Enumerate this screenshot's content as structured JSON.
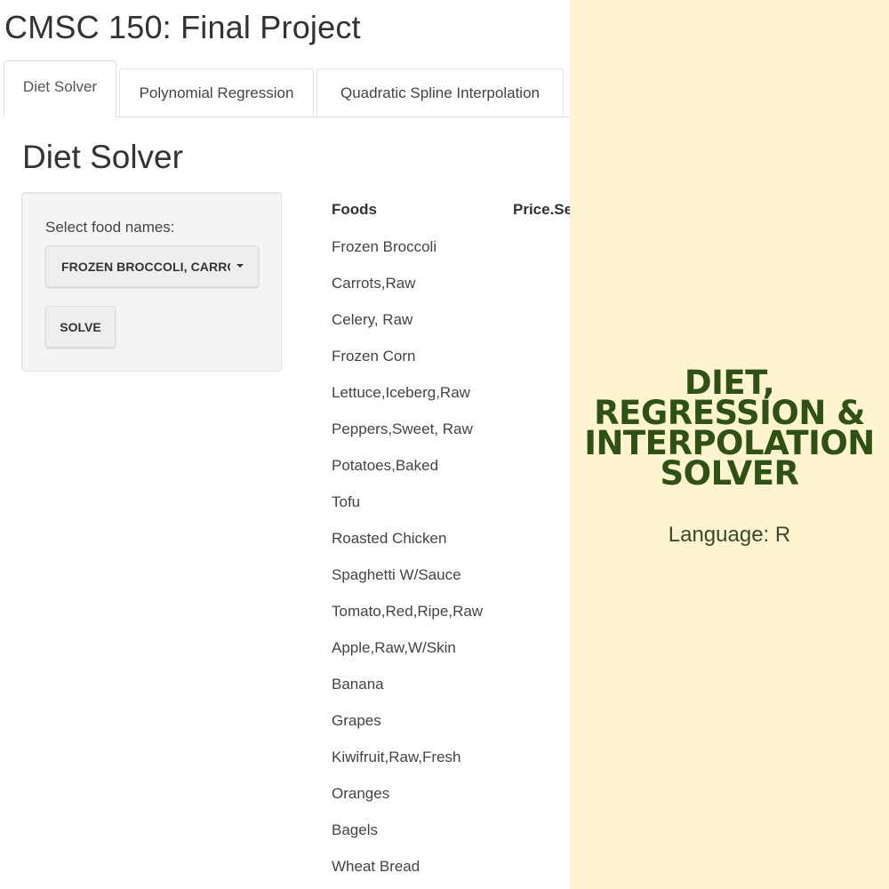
{
  "app": {
    "title": "CMSC 150: Final Project",
    "tabs": [
      {
        "label": "Diet Solver",
        "active": true
      },
      {
        "label": "Polynomial Regression",
        "active": false
      },
      {
        "label": "Quadratic Spline Interpolation",
        "active": false
      }
    ],
    "section_title": "Diet Solver",
    "sidebar": {
      "select_label": "Select food names:",
      "select_value": "FROZEN BROCCOLI, CARROTS,RAW",
      "solve_label": "SOLVE"
    },
    "table": {
      "headers": [
        "Foods",
        "Price.Serving"
      ],
      "foods": [
        "Frozen Broccoli",
        "Carrots,Raw",
        "Celery, Raw",
        "Frozen Corn",
        "Lettuce,Iceberg,Raw",
        "Peppers,Sweet, Raw",
        "Potatoes,Baked",
        "Tofu",
        "Roasted Chicken",
        "Spaghetti W/Sauce",
        "Tomato,Red,Ripe,Raw",
        "Apple,Raw,W/Skin",
        "Banana",
        "Grapes",
        "Kiwifruit,Raw,Fresh",
        "Oranges",
        "Bagels",
        "Wheat Bread"
      ]
    }
  },
  "promo": {
    "title_lines": [
      "DIET,",
      "REGRESSION &",
      "INTERPOLATION",
      "SOLVER"
    ],
    "subtitle": "Language: R",
    "background_color": "#fff4d0",
    "title_color": "#2f5115"
  }
}
